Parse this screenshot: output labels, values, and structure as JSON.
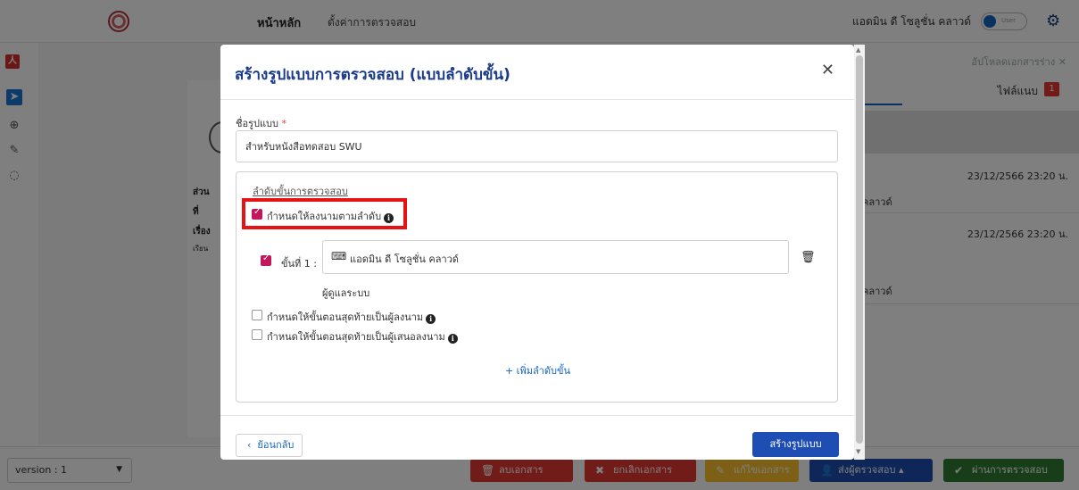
{
  "header": {
    "nav_home": "หน้าหลัก",
    "nav_settings": "ตั้งค่าการตรวจสอบ",
    "user_name": "แอดมิน ดี โซลูชั่น คลาวด์",
    "role_toggle_label": "User"
  },
  "right_panel": {
    "upload_draft": "อัปโหลดเอกสารร่าง",
    "attachments_tab": "ไฟล์แนบ",
    "attachments_count": "1",
    "history": [
      {
        "time": "23/12/2566 23:20 น.",
        "name": "น คลาวด์"
      },
      {
        "time": "23/12/2566 23:20 น.",
        "name": "น คลาวด์"
      }
    ]
  },
  "document": {
    "lines": [
      "ส่วน",
      "ที่",
      "เรื่อง",
      "เรียน"
    ]
  },
  "bottom_bar": {
    "version": "version : 1",
    "delete_doc": "ลบเอกสาร",
    "cancel_doc": "ยกเลิกเอกสาร",
    "edit_doc": "แก้ไขเอกสาร",
    "send_review": "ส่งผู้ตรวจสอบ",
    "pass_review": "ผ่านการตรวจสอบ",
    "colors": {
      "delete": "#e53935",
      "cancel": "#e53935",
      "edit": "#fbc02d",
      "send": "#1e4db3",
      "pass": "#2e7d32"
    }
  },
  "modal": {
    "title": "สร้างรูปแบบการตรวจสอบ (แบบลำดับขั้น)",
    "name_label": "ชื่อรูปแบบ",
    "name_value": "สำหรับหนังสือทดสอบ SWU",
    "sequence_title": "ลำดับขั้นการตรวจสอบ",
    "sign_in_order_label": "กำหนดให้ลงนามตามลำดับ",
    "sign_in_order_checked": true,
    "step_label": "ขั้นที่ 1 :",
    "step_checked": true,
    "step_assignee": "แอดมิน ดี โซลูชั่น คลาวด์",
    "admin_label": "ผู้ดูแลระบบ",
    "last_step_signer_label": "กำหนดให้ขั้นตอนสุดท้ายเป็นผู้ลงนาม",
    "last_step_proposer_label": "กำหนดให้ขั้นตอนสุดท้ายเป็นผู้เสนอลงนาม",
    "add_step": "+ เพิ่มลำดับขั้น",
    "back": "ย้อนกลับ",
    "create": "สร้างรูปแบบ"
  }
}
